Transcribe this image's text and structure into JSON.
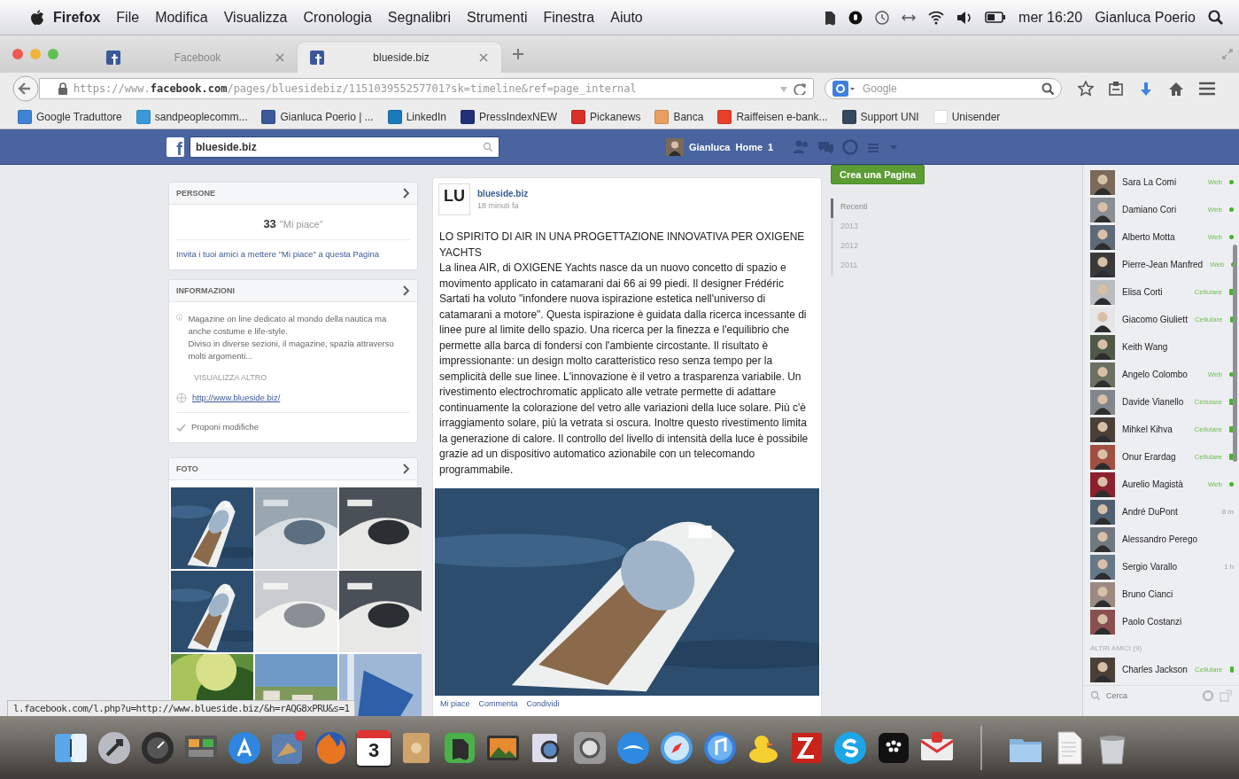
{
  "menubar": {
    "items": [
      "Firefox",
      "File",
      "Modifica",
      "Visualizza",
      "Cronologia",
      "Segnalibri",
      "Strumenti",
      "Finestra",
      "Aiuto"
    ],
    "clock": "mer 16:20",
    "user": "Gianluca Poerio"
  },
  "tabs": [
    {
      "label": "Facebook",
      "selected": false
    },
    {
      "label": "blueside.biz",
      "selected": true
    }
  ],
  "address": {
    "url": "https://www.**facebook.com**/pages/bluesidebiz/115103955257701?sk=timeline&ref=page_internal"
  },
  "search": {
    "placeholder": "Google"
  },
  "bookmarks": [
    {
      "label": "Google Traduttore",
      "color": "#3f83d6"
    },
    {
      "label": "sandpeoplecomm...",
      "color": "#3a9ad9"
    },
    {
      "label": "Gianluca Poerio | ...",
      "color": "#3b5998"
    },
    {
      "label": "LinkedIn",
      "color": "#1a7bbb"
    },
    {
      "label": "PressIndexNEW",
      "color": "#22307a"
    },
    {
      "label": "Pickanews",
      "color": "#d8302a"
    },
    {
      "label": "Banca",
      "color": "#e8a060"
    },
    {
      "label": "Raiffeisen e-bank...",
      "color": "#e8402a"
    },
    {
      "label": "Support UNI",
      "color": "#34495e"
    },
    {
      "label": "Unisender",
      "color": "#ffffff"
    }
  ],
  "fb_bar": {
    "logo": "f",
    "search_value": "blueside.biz",
    "user": "Gianluca",
    "home": "Home",
    "home_count": "1"
  },
  "left": {
    "people": {
      "title": "PERSONE",
      "count": "33",
      "count_label": "\"Mi piace\"",
      "invite": "Invita i tuoi amici a mettere \"Mi piace\" a questa Pagina"
    },
    "info": {
      "title": "INFORMAZIONI",
      "about": "Magazine on line dedicato al mondo della nautica ma anche costume e life-style.\nDiviso in diverse sezioni, il magazine, spazia attraverso molti argomenti...",
      "more": "VISUALIZZA ALTRO",
      "website": "http://www.blueside.biz/",
      "suggest": "Proponi modifiche"
    },
    "photos": {
      "title": "FOTO"
    }
  },
  "post": {
    "avatar_text": "LU",
    "author": "blueside.biz",
    "time": "18 minuti fa",
    "title": "LO SPIRITO DI AIR IN UNA PROGETTAZIONE INNOVATIVA PER OXIGENE YACHTS",
    "body": "La linea AIR, di OXIGENE Yachts nasce da un nuovo concetto di spazio e movimento applicato in catamarani dai 66 ai 99 piedi. Il designer Frédéric Sartati ha voluto \"infondere nuova ispirazione estetica nell'universo di catamarani a motore\". Questa ispirazione è guidata dalla ricerca incessante di linee pure al limite dello spazio. Una ricerca per la finezza e l'equilibrio che permette alla barca di fondersi con l'ambiente circostante. Il risultato è impressionante: un design molto caratteristico reso senza tempo per la semplicità delle sue linee. L'innovazione è il vetro a trasparenza variabile. Un rivestimento electrochromatic applicato alle vetrate permette di adattare continuamente la colorazione del vetro alle variazioni della luce solare. Più c'è irraggiamento solare, più la vetrata si oscura. Inoltre questo rivestimento limita la generazione di calore. Il controllo del livello di intensità della luce è possibile grazie ad un dispositivo automatico azionabile con un telecomando programmabile.",
    "actions": [
      "Mi piace",
      "Commenta",
      "Condividi"
    ]
  },
  "create_page": "Crea una Pagina",
  "timeline": [
    {
      "label": "Recenti",
      "selected": true
    },
    {
      "label": "2013",
      "selected": false
    },
    {
      "label": "2012",
      "selected": false
    },
    {
      "label": "2011",
      "selected": false
    }
  ],
  "chat": {
    "friends": [
      {
        "name": "Sara La Comi",
        "status": "Web",
        "kind": "web"
      },
      {
        "name": "Damiano Cori",
        "status": "Web",
        "kind": "web"
      },
      {
        "name": "Alberto Motta",
        "status": "Web",
        "kind": "web"
      },
      {
        "name": "Pierre-Jean Manfred",
        "status": "Web",
        "kind": "web"
      },
      {
        "name": "Elisa Corti",
        "status": "Cellulare",
        "kind": "mobile"
      },
      {
        "name": "Giacomo Giuliett",
        "status": "Cellulare",
        "kind": "mobile"
      },
      {
        "name": "Keith Wang",
        "kind": "offline"
      },
      {
        "name": "Angelo Colombo",
        "status": "Web",
        "kind": "web"
      },
      {
        "name": "Davide Vianello",
        "status": "Cellulare",
        "kind": "mobile"
      },
      {
        "name": "Mihkel Kihva",
        "status": "Cellulare",
        "kind": "mobile"
      },
      {
        "name": "Onur Erardag",
        "status": "Cellulare",
        "kind": "mobile"
      },
      {
        "name": "Aurelio Magistà",
        "status": "Web",
        "kind": "web"
      },
      {
        "name": "André DuPont",
        "status": "8 m",
        "kind": "idle"
      },
      {
        "name": "Alessandro Perego",
        "kind": "offline"
      },
      {
        "name": "Sergio Varallo",
        "status": "1 h",
        "kind": "idle"
      },
      {
        "name": "Bruno Cianci",
        "kind": "offline"
      },
      {
        "name": "Paolo Costanzi",
        "kind": "offline"
      }
    ],
    "others_title": "ALTRI AMICI (9)",
    "others": [
      {
        "name": "Charles Jackson",
        "status": "Cellulare",
        "kind": "mobile"
      }
    ],
    "search_placeholder": "Cerca"
  },
  "status_bar": "l.facebook.com/l.php?u=http://www.blueside.biz/&h=rAQG8xPRU&s=1",
  "dock": {
    "calendar_day": "3"
  }
}
